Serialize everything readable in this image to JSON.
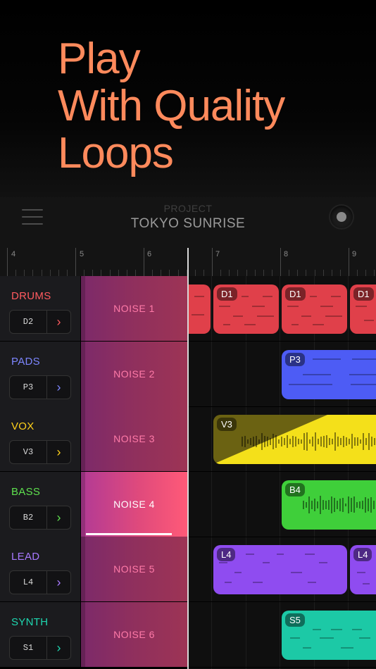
{
  "hero": {
    "lines": [
      "Play",
      "With Quality",
      "Loops"
    ]
  },
  "header": {
    "label": "PROJECT",
    "title": "TOKYO SUNRISE",
    "menu_icon": "hamburger-menu-icon",
    "record_icon": "record-dot-icon"
  },
  "ruler": {
    "numbers": [
      "4",
      "5",
      "6",
      "7",
      "8",
      "9"
    ]
  },
  "tracks": [
    {
      "name": "DRUMS",
      "color": "#ff5a5f",
      "selected": "D2",
      "noise": "NOISE 1",
      "clip_color": "#e0404a"
    },
    {
      "name": "PADS",
      "color": "#7d86ff",
      "selected": "P3",
      "noise": "NOISE 2",
      "clip_color": "#4d5cf5"
    },
    {
      "name": "VOX",
      "color": "#ffd21a",
      "selected": "V3",
      "noise": "NOISE 3",
      "clip_color": "#f4e01a"
    },
    {
      "name": "BASS",
      "color": "#5ee04e",
      "selected": "B2",
      "noise": "NOISE 4",
      "clip_color": "#3fcf3a"
    },
    {
      "name": "LEAD",
      "color": "#a879ff",
      "selected": "L4",
      "noise": "NOISE 5",
      "clip_color": "#8f4cf0"
    },
    {
      "name": "SYNTH",
      "color": "#1ed7b0",
      "selected": "S1",
      "noise": "NOISE 6",
      "clip_color": "#1cc9a6"
    }
  ],
  "active_noise": "NOISE 4",
  "clips": {
    "drums": [
      "D1",
      "D1",
      "D1"
    ],
    "pads": [
      "P3"
    ],
    "vox": [
      "V3"
    ],
    "bass": [
      "B4"
    ],
    "lead": [
      "L4",
      "L4"
    ],
    "synth": [
      "S5"
    ]
  }
}
